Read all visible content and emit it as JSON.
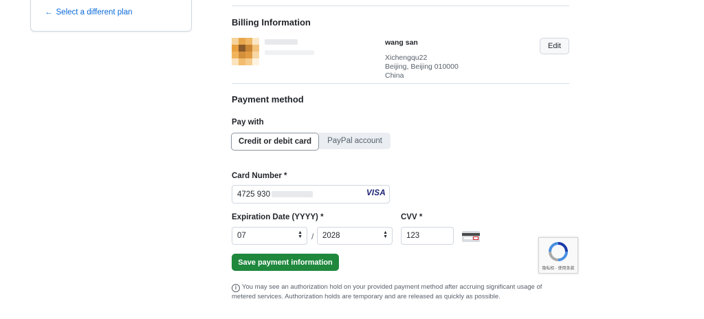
{
  "left_card": {
    "back_link": "Select a different plan"
  },
  "billing": {
    "title": "Billing Information",
    "name": "wang san",
    "address_line1": "Xichengqu22",
    "address_line2": "Beijing, Beijing 010000",
    "country": "China",
    "edit_label": "Edit"
  },
  "payment": {
    "title": "Payment method",
    "pay_with_label": "Pay with",
    "options": [
      "Credit or debit card",
      "PayPal account"
    ],
    "selected": "Credit or debit card",
    "card_number_label": "Card Number *",
    "card_number_value": "4725 930",
    "card_brand": "VISA",
    "expiration_label": "Expiration Date (YYYY) *",
    "exp_month": "07",
    "exp_separator": "/",
    "exp_year": "2028",
    "cvv_label": "CVV *",
    "cvv_value": "123",
    "save_label": "Save payment information",
    "note": "You may see an authorization hold on your provided payment method after accruing significant usage of metered services. Authorization holds are temporary and are released as quickly as possible."
  },
  "recaptcha": {
    "text": "隐私权 - 使用条款"
  },
  "colors": {
    "primary_button": "#1f883d",
    "link": "#0969da",
    "visa": "#1a1f71"
  },
  "icons": {
    "back": "arrow-left-icon",
    "info": "info-icon",
    "select": "chevron-updown-icon",
    "recaptcha": "recaptcha-icon"
  }
}
